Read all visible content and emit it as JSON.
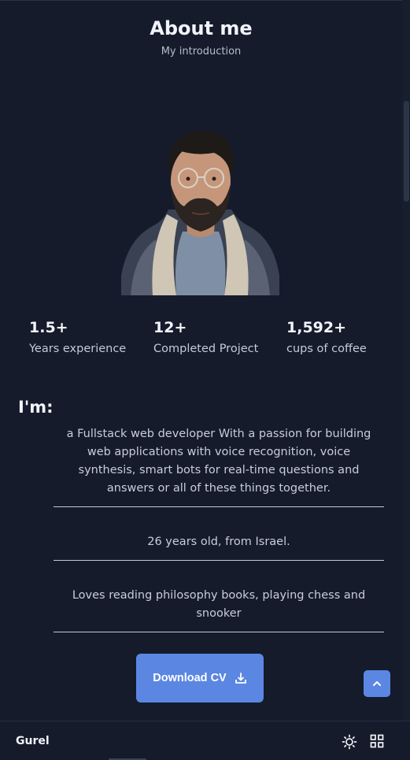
{
  "section": {
    "title": "About me",
    "subtitle": "My introduction"
  },
  "stats": [
    {
      "value": "1.5+",
      "label": "Years experience"
    },
    {
      "value": "12+",
      "label": "Completed Project"
    },
    {
      "value": "1,592+",
      "label": "cups of coffee"
    }
  ],
  "intro": {
    "heading": "I'm:",
    "facts": [
      "a Fullstack web developer With a passion for building web applications with voice recognition, voice synthesis, smart bots for real-time questions and answers or all of these things together.",
      "26 years old, from Israel.",
      "Loves reading philosophy books, playing chess and snooker"
    ]
  },
  "actions": {
    "download_label": "Download CV",
    "download_icon": "download-icon",
    "scroll_up_icon": "chevron-up-icon"
  },
  "footer": {
    "brand": "Gurel",
    "theme_icon": "sun-icon",
    "menu_icon": "grid-icon"
  },
  "colors": {
    "background": "#151b2b",
    "accent": "#5b87e3",
    "text": "#f2f4fa",
    "muted_text": "#c5cad6"
  }
}
